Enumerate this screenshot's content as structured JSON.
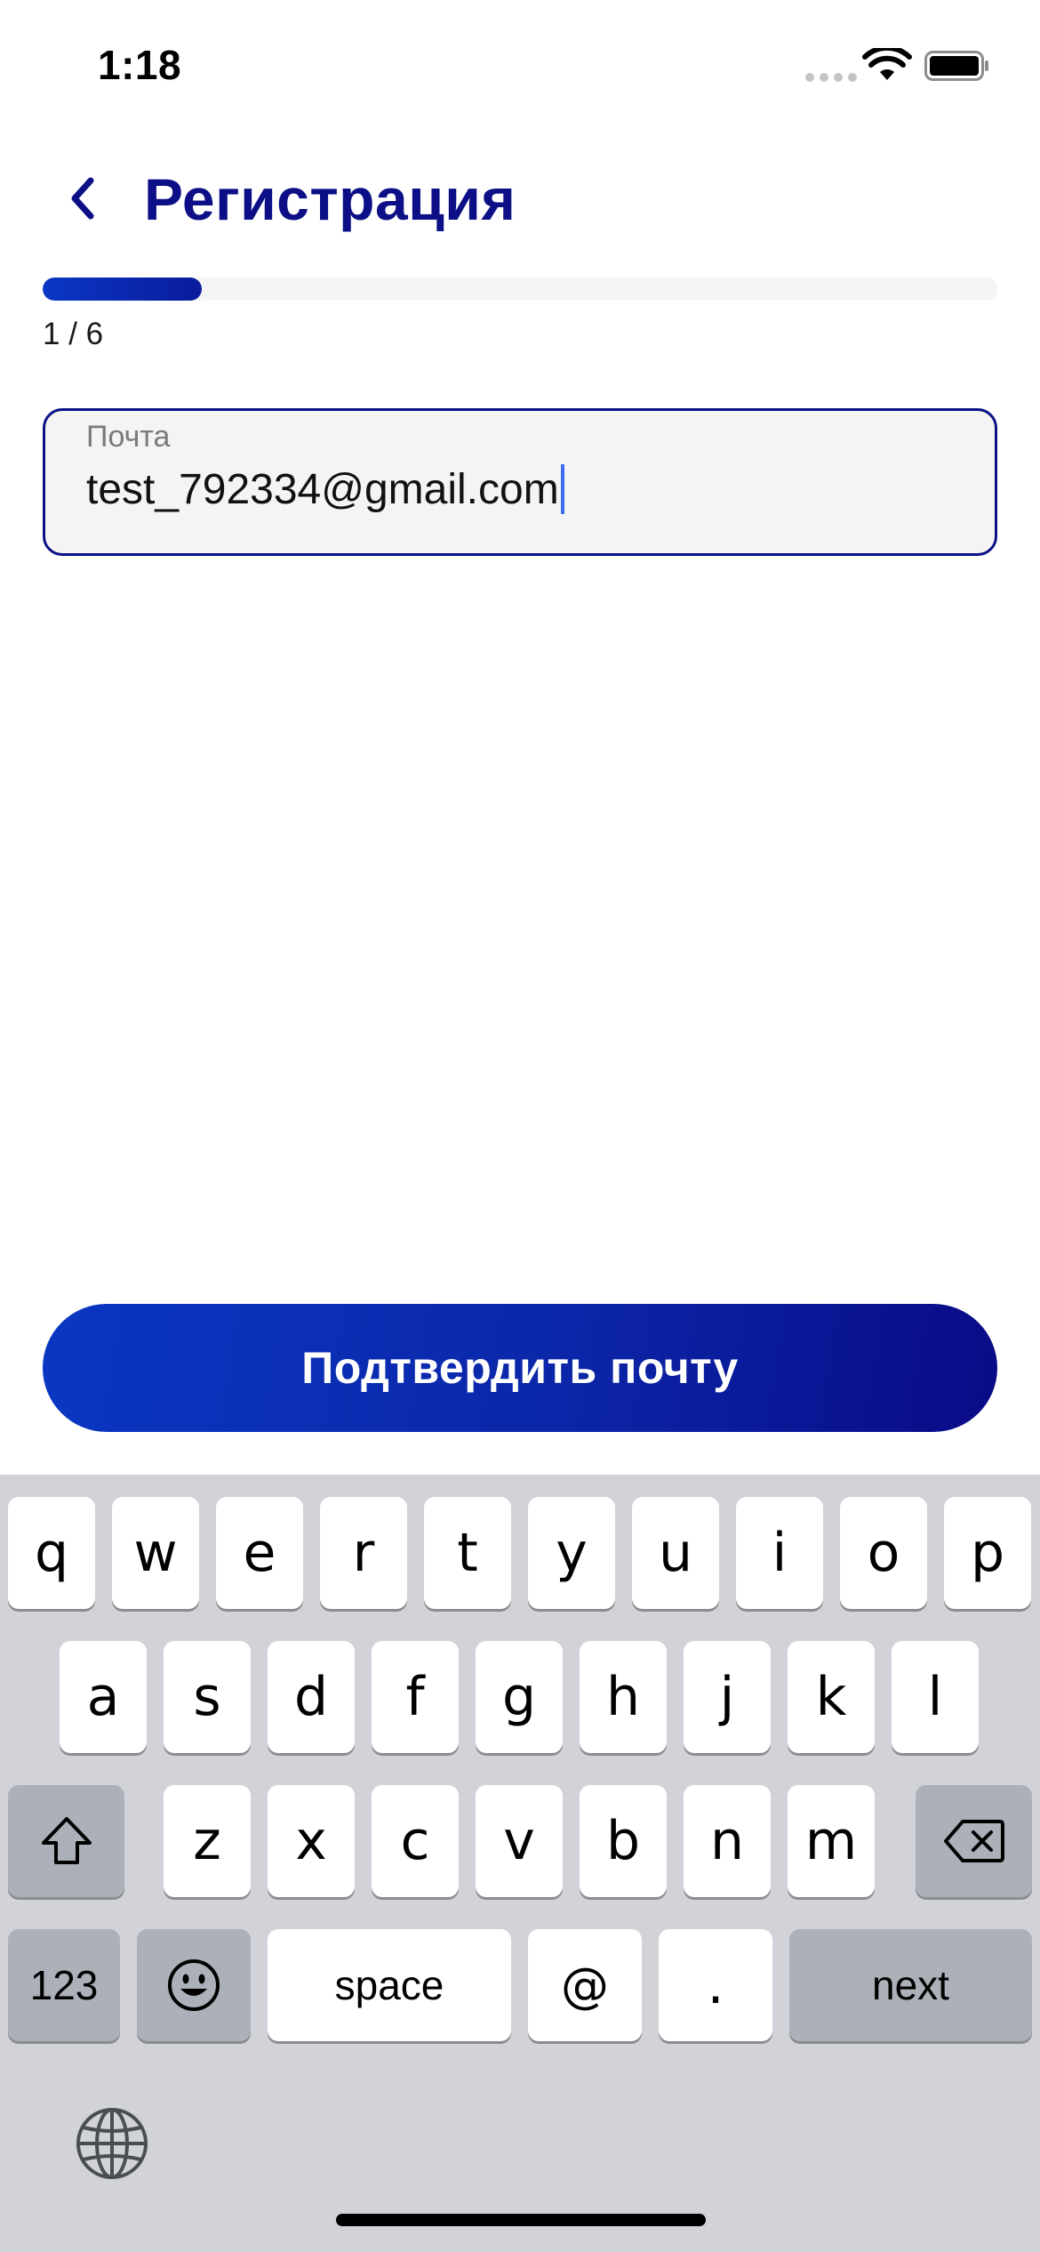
{
  "status_bar": {
    "time": "1:18"
  },
  "header": {
    "title": "Регистрация"
  },
  "progress": {
    "text": "1 / 6",
    "current": 1,
    "total": 6
  },
  "email_field": {
    "label": "Почта",
    "value": "test_792334@gmail.com"
  },
  "confirm_button": {
    "label": "Подтвердить почту"
  },
  "keyboard": {
    "row1": [
      "q",
      "w",
      "e",
      "r",
      "t",
      "y",
      "u",
      "i",
      "o",
      "p"
    ],
    "row2": [
      "a",
      "s",
      "d",
      "f",
      "g",
      "h",
      "j",
      "k",
      "l"
    ],
    "row3": [
      "z",
      "x",
      "c",
      "v",
      "b",
      "n",
      "m"
    ],
    "numbers_key": "123",
    "space_key": "space",
    "at_key": "@",
    "dot_key": ".",
    "next_key": "next"
  },
  "colors": {
    "accent": "#0c0f86",
    "button_start": "#0a37c2",
    "button_end": "#0a0a86",
    "caret": "#3d6df2"
  },
  "icons": [
    "back-chevron-icon",
    "wifi-icon",
    "battery-icon",
    "cellular-signal-icon",
    "shift-icon",
    "backspace-icon",
    "emoji-icon",
    "globe-icon"
  ]
}
